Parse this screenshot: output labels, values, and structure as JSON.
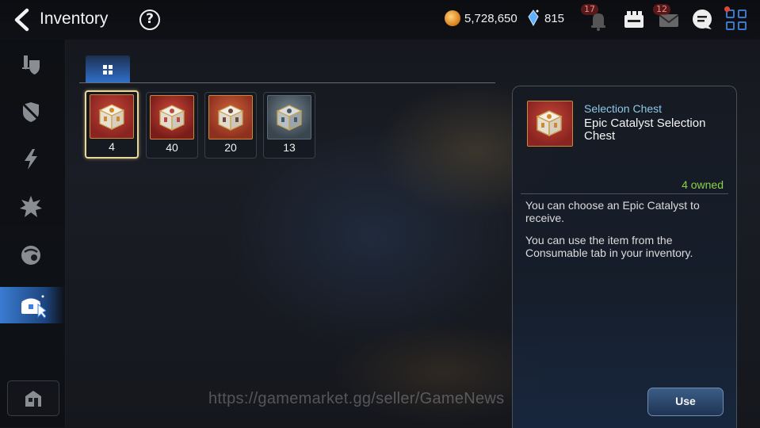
{
  "header": {
    "title": "Inventory",
    "help_label": "?",
    "gold": "5,728,650",
    "crystals": "815",
    "notification_count": "17",
    "mail_count": "12"
  },
  "sidebar": {
    "items": [
      {
        "icon": "sword-shield-icon",
        "active": false
      },
      {
        "icon": "armor-icon",
        "active": false
      },
      {
        "icon": "lightning-icon",
        "active": false
      },
      {
        "icon": "burst-icon",
        "active": false
      },
      {
        "icon": "materials-icon",
        "active": false
      },
      {
        "icon": "chest-icon",
        "active": true
      }
    ],
    "bottom_icon": "storage-icon"
  },
  "tabs": {
    "active": "grid-tab"
  },
  "items": [
    {
      "quantity": "4",
      "bg": "red",
      "selected": true
    },
    {
      "quantity": "40",
      "bg": "red2",
      "selected": false
    },
    {
      "quantity": "20",
      "bg": "orange",
      "selected": false
    },
    {
      "quantity": "13",
      "bg": "grey",
      "selected": false
    }
  ],
  "detail": {
    "category": "Selection Chest",
    "name": "Epic Catalyst Selection Chest",
    "owned": "4 owned",
    "description_1": "You can choose an Epic Catalyst to receive.",
    "description_2": "You can use the item from the Consumable tab in your inventory.",
    "use_label": "Use"
  },
  "watermark": "https://gamemarket.gg/seller/GameNews",
  "colors": {
    "accent": "#3c82dc",
    "owned": "#8bd14a",
    "category": "#8fc8e8",
    "selected_border": "#e9d79a"
  }
}
